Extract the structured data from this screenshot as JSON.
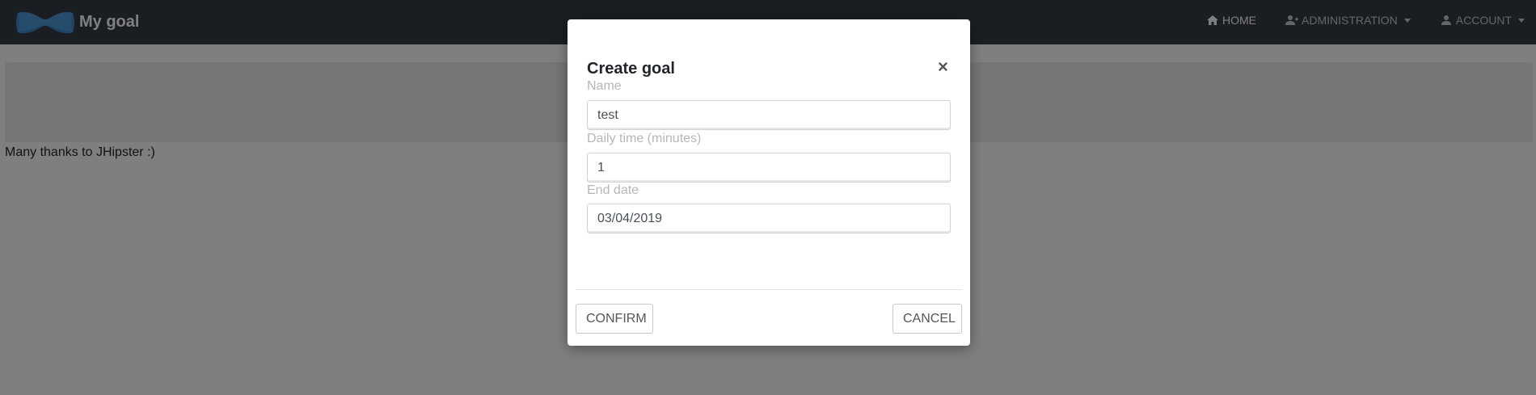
{
  "navbar": {
    "brand_title": "My goal",
    "items": [
      {
        "label": "HOME",
        "icon": "home-icon",
        "active": true
      },
      {
        "label": "ADMINISTRATION",
        "icon": "user-plus-icon",
        "dropdown": true
      },
      {
        "label": "ACCOUNT",
        "icon": "user-icon",
        "dropdown": true
      }
    ],
    "background": "#353d47"
  },
  "page": {
    "footer_text": "Many thanks to JHipster :)"
  },
  "modal": {
    "title": "Create goal",
    "close_symbol": "×",
    "fields": {
      "name": {
        "label": "Name",
        "value": "test"
      },
      "daily_time": {
        "label": "Daily time (minutes)",
        "value": "1"
      },
      "end_date": {
        "label": "End date",
        "value": "03/04/2019"
      }
    },
    "confirm_label": "CONFIRM",
    "cancel_label": "CANCEL"
  }
}
